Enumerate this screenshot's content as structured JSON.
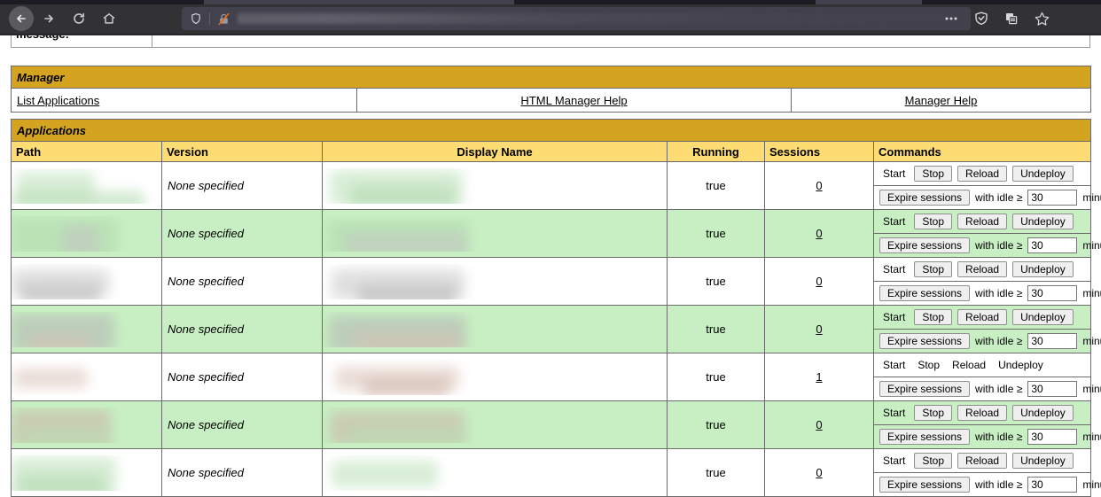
{
  "browser": {
    "nav": {
      "back_title": "Back",
      "forward_title": "Forward",
      "reload_title": "Reload",
      "home_title": "Home"
    },
    "urlbar": {
      "shield_title": "Tracking Protection",
      "insecure_title": "Connection is not secure",
      "url_value": "",
      "placeholder": ""
    },
    "actions": [
      {
        "name": "page-actions-icon",
        "label": "…"
      },
      {
        "name": "reader-mode-icon",
        "label": ""
      },
      {
        "name": "library-icon",
        "label": ""
      },
      {
        "name": "bookmark-star-icon",
        "label": ""
      }
    ]
  },
  "message_row": {
    "label": "message:",
    "value": ""
  },
  "manager": {
    "title": "Manager",
    "links": [
      {
        "label": "List Applications",
        "align": "left"
      },
      {
        "label": "HTML Manager Help",
        "align": "center"
      },
      {
        "label": "Manager Help",
        "align": "center"
      }
    ]
  },
  "applications": {
    "title": "Applications",
    "columns": [
      "Path",
      "Version",
      "Display Name",
      "Running",
      "Sessions",
      "Commands"
    ],
    "commands_labels": {
      "start": "Start",
      "stop": "Stop",
      "reload": "Reload",
      "undeploy": "Undeploy",
      "expire": "Expire sessions",
      "idle_prefix": "with idle ≥",
      "idle_suffix": "minutes",
      "idle_value": "30"
    },
    "rows": [
      {
        "path": "",
        "version": "None specified",
        "display_name": "",
        "running": "true",
        "sessions": "0",
        "stripe": "white",
        "commands_style": "buttons",
        "idle_value": "30"
      },
      {
        "path": "",
        "version": "None specified",
        "display_name": "",
        "running": "true",
        "sessions": "0",
        "stripe": "green",
        "commands_style": "buttons",
        "idle_value": "30"
      },
      {
        "path": "",
        "version": "None specified",
        "display_name": "",
        "running": "true",
        "sessions": "0",
        "stripe": "white",
        "commands_style": "buttons",
        "idle_value": "30"
      },
      {
        "path": "",
        "version": "None specified",
        "display_name": "",
        "running": "true",
        "sessions": "0",
        "stripe": "green",
        "commands_style": "buttons",
        "idle_value": "30"
      },
      {
        "path": "",
        "version": "None specified",
        "display_name": "",
        "running": "true",
        "sessions": "1",
        "stripe": "white",
        "commands_style": "text",
        "idle_value": "30"
      },
      {
        "path": "",
        "version": "None specified",
        "display_name": "",
        "running": "true",
        "sessions": "0",
        "stripe": "green",
        "commands_style": "buttons",
        "idle_value": "30"
      },
      {
        "path": "",
        "version": "None specified",
        "display_name": "",
        "running": "true",
        "sessions": "0",
        "stripe": "white",
        "commands_style": "buttons",
        "idle_value": "30"
      }
    ]
  },
  "colors": {
    "section_header": "#D4A420",
    "column_header": "#FDDC74",
    "row_stripe_green": "#C8EFC3",
    "row_stripe_white": "#FFFFFF",
    "chrome_bg": "#323234",
    "border": "#6B6B6B"
  }
}
